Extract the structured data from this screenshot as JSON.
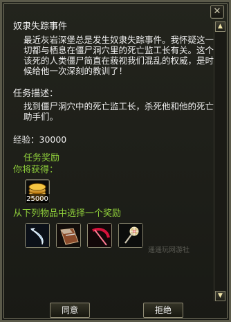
{
  "quest": {
    "title": "奴隶失踪事件",
    "description": "最近灰岩深堡总是发生奴隶失踪事件。我怀疑这一切都与栖息在僵尸洞穴里的死亡监工长有关。这个该死的人类僵尸简直在藐视我们混乱的权威，是时候给他一次深刻的教训了！",
    "section_label": "任务描述：",
    "task_text": "找到僵尸洞穴中的死亡监工长，杀死他和他的死亡助手们。",
    "exp_text": "经验：30000"
  },
  "rewards": {
    "title": "任务奖励",
    "get_label": "你将获得：",
    "gold_amount": "25000",
    "choose_label": "从下列物品中选择一个奖励",
    "choices": [
      {
        "icon": "curved-blade-icon"
      },
      {
        "icon": "arm-guard-icon"
      },
      {
        "icon": "crimson-scythe-icon"
      },
      {
        "icon": "staff-icon"
      }
    ]
  },
  "watermark": "遥遥玩网游社",
  "buttons": {
    "accept": "同意",
    "refuse": "拒绝"
  },
  "colors": {
    "green": "#8fcf3b",
    "text": "#f0f0f0",
    "border": "#8d8a72"
  }
}
